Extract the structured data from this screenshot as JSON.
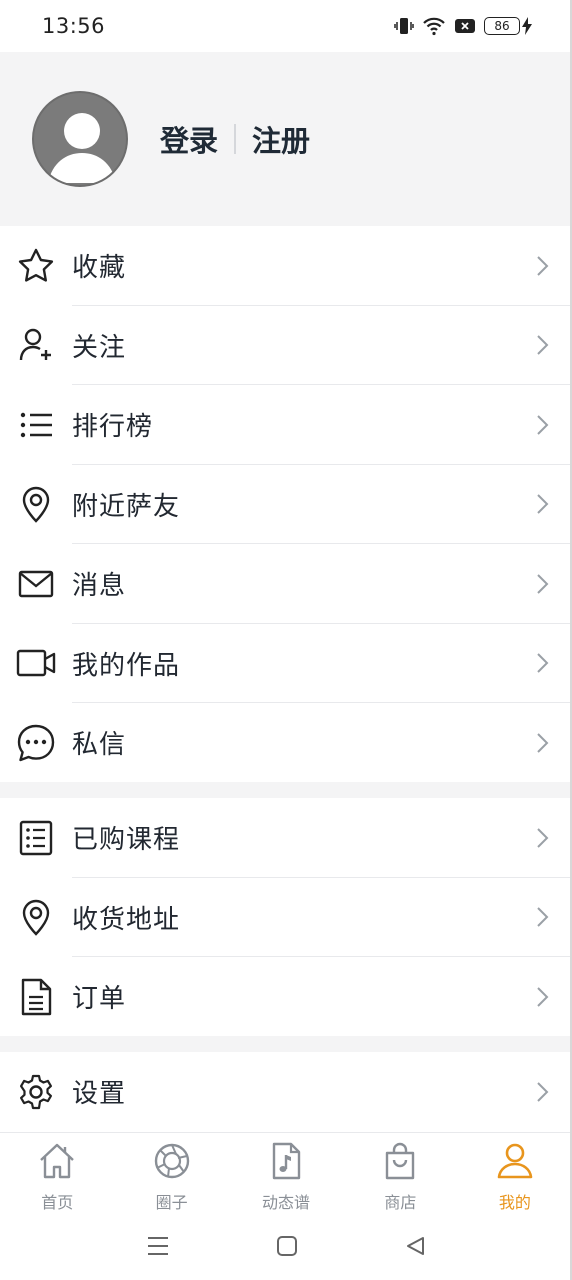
{
  "status_bar": {
    "time": "13:56",
    "battery_level": "86",
    "icons": [
      "vibrate-icon",
      "wifi-icon",
      "sim-x-icon",
      "battery-icon",
      "charging-icon"
    ]
  },
  "profile": {
    "login_label": "登录",
    "register_label": "注册"
  },
  "menu_group_1": [
    {
      "label": "收藏",
      "icon": "star-icon"
    },
    {
      "label": "关注",
      "icon": "user-plus-icon"
    },
    {
      "label": "排行榜",
      "icon": "list-icon"
    },
    {
      "label": "附近萨友",
      "icon": "location-pin-icon"
    },
    {
      "label": "消息",
      "icon": "mail-icon"
    },
    {
      "label": "我的作品",
      "icon": "video-camera-icon"
    },
    {
      "label": "私信",
      "icon": "chat-bubble-icon"
    }
  ],
  "menu_group_2": [
    {
      "label": "已购课程",
      "icon": "checklist-icon"
    },
    {
      "label": "收货地址",
      "icon": "location-pin-icon"
    },
    {
      "label": "订单",
      "icon": "document-icon"
    }
  ],
  "menu_group_3": [
    {
      "label": "设置",
      "icon": "gear-icon"
    }
  ],
  "tab_bar": [
    {
      "label": "首页",
      "icon": "home-icon",
      "active": false
    },
    {
      "label": "圈子",
      "icon": "aperture-icon",
      "active": false
    },
    {
      "label": "动态谱",
      "icon": "music-file-icon",
      "active": false
    },
    {
      "label": "商店",
      "icon": "shopping-bag-icon",
      "active": false
    },
    {
      "label": "我的",
      "icon": "person-icon",
      "active": true
    }
  ],
  "colors": {
    "accent": "#e8951d",
    "text": "#222831",
    "muted": "#8a8f96",
    "section_bg": "#f4f4f5"
  }
}
